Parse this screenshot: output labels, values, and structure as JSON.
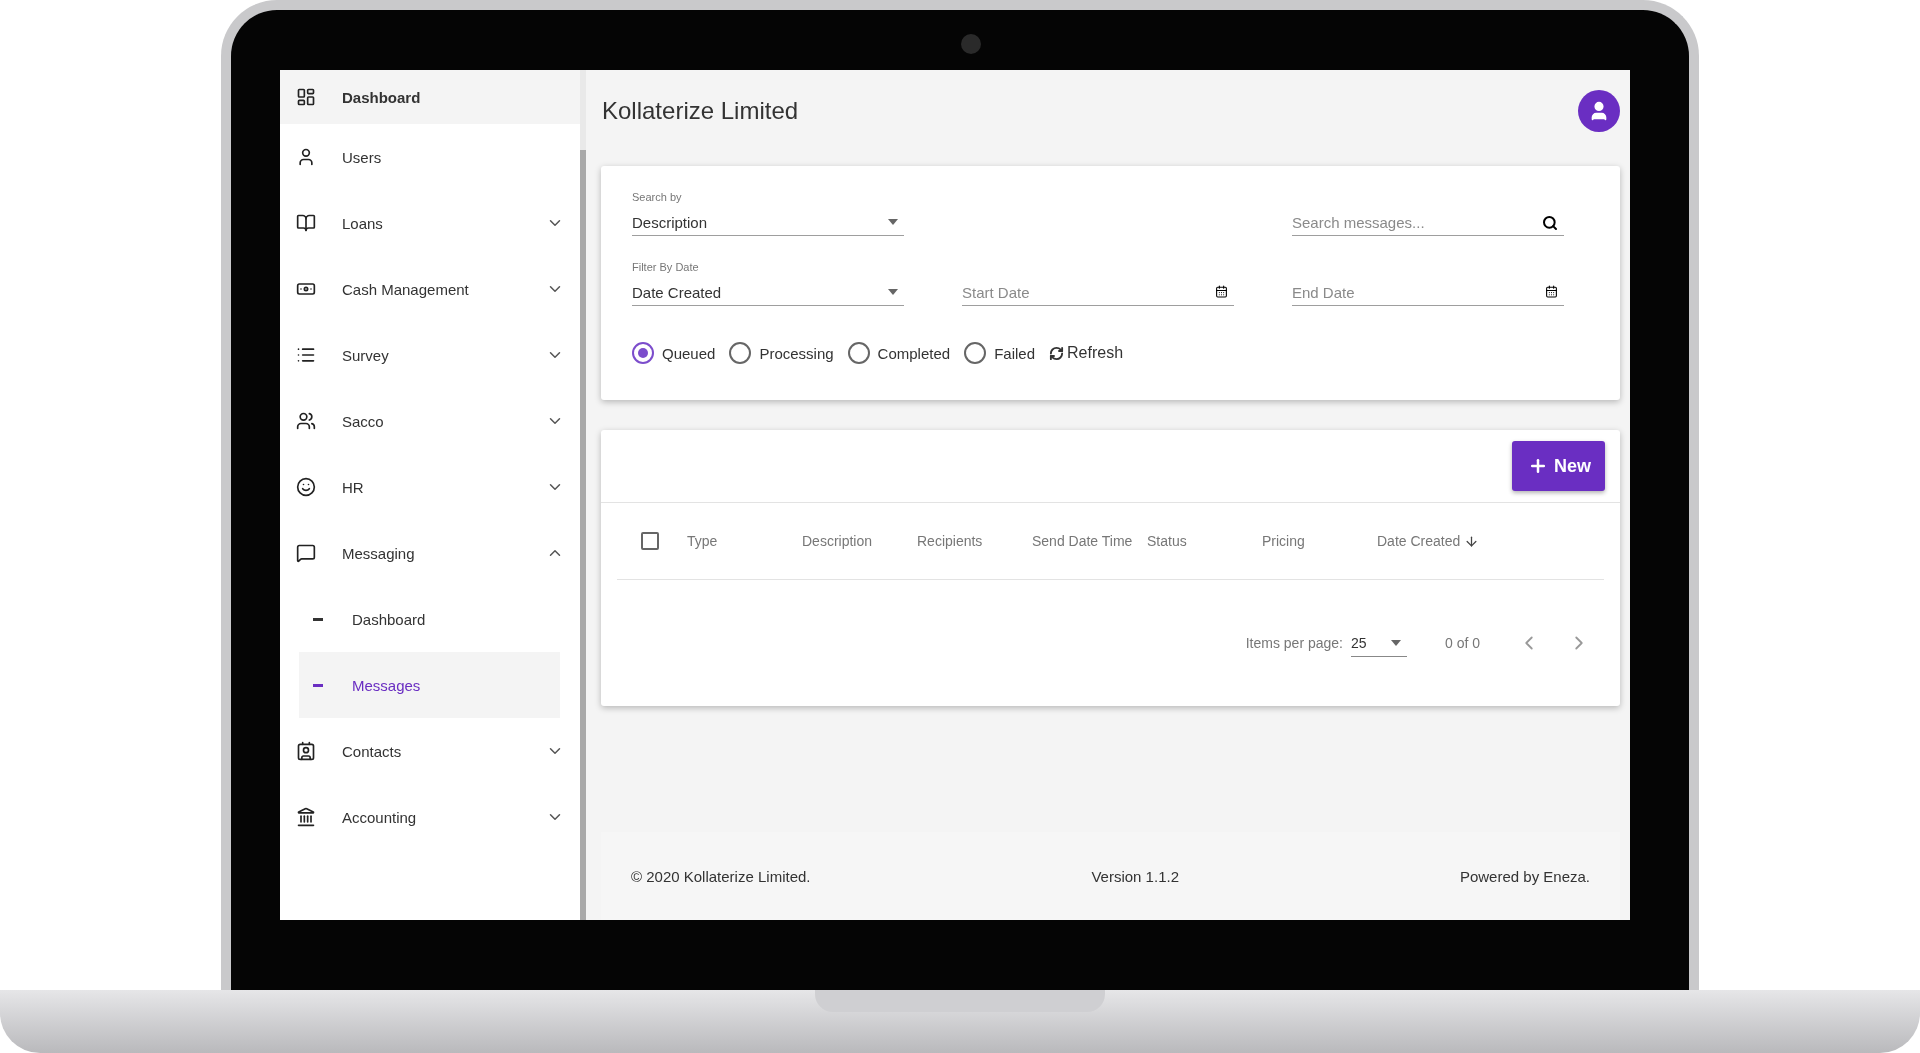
{
  "sidebar": {
    "items": [
      {
        "label": "Dashboard",
        "kind": "link",
        "selected": true
      },
      {
        "label": "Users",
        "kind": "link",
        "selected": false
      },
      {
        "label": "Loans",
        "kind": "group",
        "expanded": false
      },
      {
        "label": "Cash Management",
        "kind": "group",
        "expanded": false
      },
      {
        "label": "Survey",
        "kind": "group",
        "expanded": false
      },
      {
        "label": "Sacco",
        "kind": "group",
        "expanded": false
      },
      {
        "label": "HR",
        "kind": "group",
        "expanded": false
      },
      {
        "label": "Messaging",
        "kind": "group",
        "expanded": true,
        "children": [
          {
            "label": "Dashboard",
            "selected": false
          },
          {
            "label": "Messages",
            "selected": true
          }
        ]
      },
      {
        "label": "Contacts",
        "kind": "group",
        "expanded": false
      },
      {
        "label": "Accounting",
        "kind": "group",
        "expanded": false
      }
    ]
  },
  "header": {
    "title": "Kollaterize Limited"
  },
  "filters": {
    "search_by": {
      "label": "Search by",
      "value": "Description"
    },
    "search": {
      "placeholder": "Search messages..."
    },
    "filter_by_date": {
      "label": "Filter By Date",
      "value": "Date Created"
    },
    "start_date": {
      "placeholder": "Start Date"
    },
    "end_date": {
      "placeholder": "End Date"
    },
    "status_options": [
      {
        "label": "Queued",
        "selected": true
      },
      {
        "label": "Processing",
        "selected": false
      },
      {
        "label": "Completed",
        "selected": false
      },
      {
        "label": "Failed",
        "selected": false
      }
    ],
    "refresh_button": "Refresh"
  },
  "table": {
    "new_button": "New",
    "select_all": {
      "checked": false
    },
    "columns": [
      {
        "label": "Type",
        "sorted": false
      },
      {
        "label": "Description",
        "sorted": false
      },
      {
        "label": "Recipients",
        "sorted": false
      },
      {
        "label": "Send Date Time",
        "sorted": false
      },
      {
        "label": "Status",
        "sorted": false
      },
      {
        "label": "Pricing",
        "sorted": false
      },
      {
        "label": "Date Created",
        "sorted": true
      }
    ],
    "pagination": {
      "items_per_page_label": "Items per page:",
      "page_size": "25",
      "range": "0 of 0"
    }
  },
  "footer": {
    "copyright": "© 2020 Kollaterize Limited.",
    "version": "Version 1.1.2",
    "powered_by": "Powered by Eneza."
  }
}
